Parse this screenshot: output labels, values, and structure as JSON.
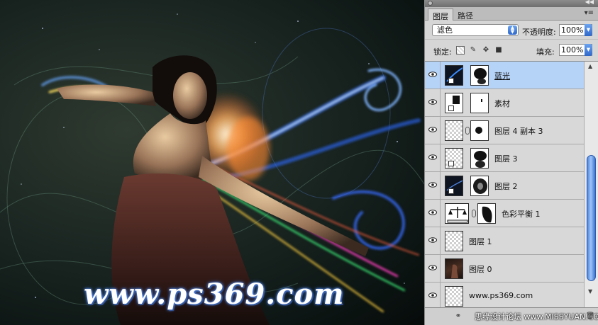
{
  "canvas": {
    "watermark": "www.ps369.com"
  },
  "panel": {
    "tabs": [
      {
        "label": "图层"
      },
      {
        "label": "路径"
      }
    ],
    "blend_mode": "滤色",
    "opacity_label": "不透明度:",
    "opacity_value": "100%",
    "lock_label": "锁定:",
    "fill_label": "填充:",
    "fill_value": "100%",
    "layers": [
      {
        "name": "蓝光",
        "selected": true
      },
      {
        "name": "素材"
      },
      {
        "name": "图层 4 副本 3"
      },
      {
        "name": "图层 3"
      },
      {
        "name": "图层 2"
      },
      {
        "name": "色彩平衡 1"
      },
      {
        "name": "图层 1"
      },
      {
        "name": "图层 0"
      },
      {
        "name": "www.ps369.com"
      }
    ],
    "bottom_watermark": "思缘设计论坛 www.MISSYUAN.COM"
  }
}
